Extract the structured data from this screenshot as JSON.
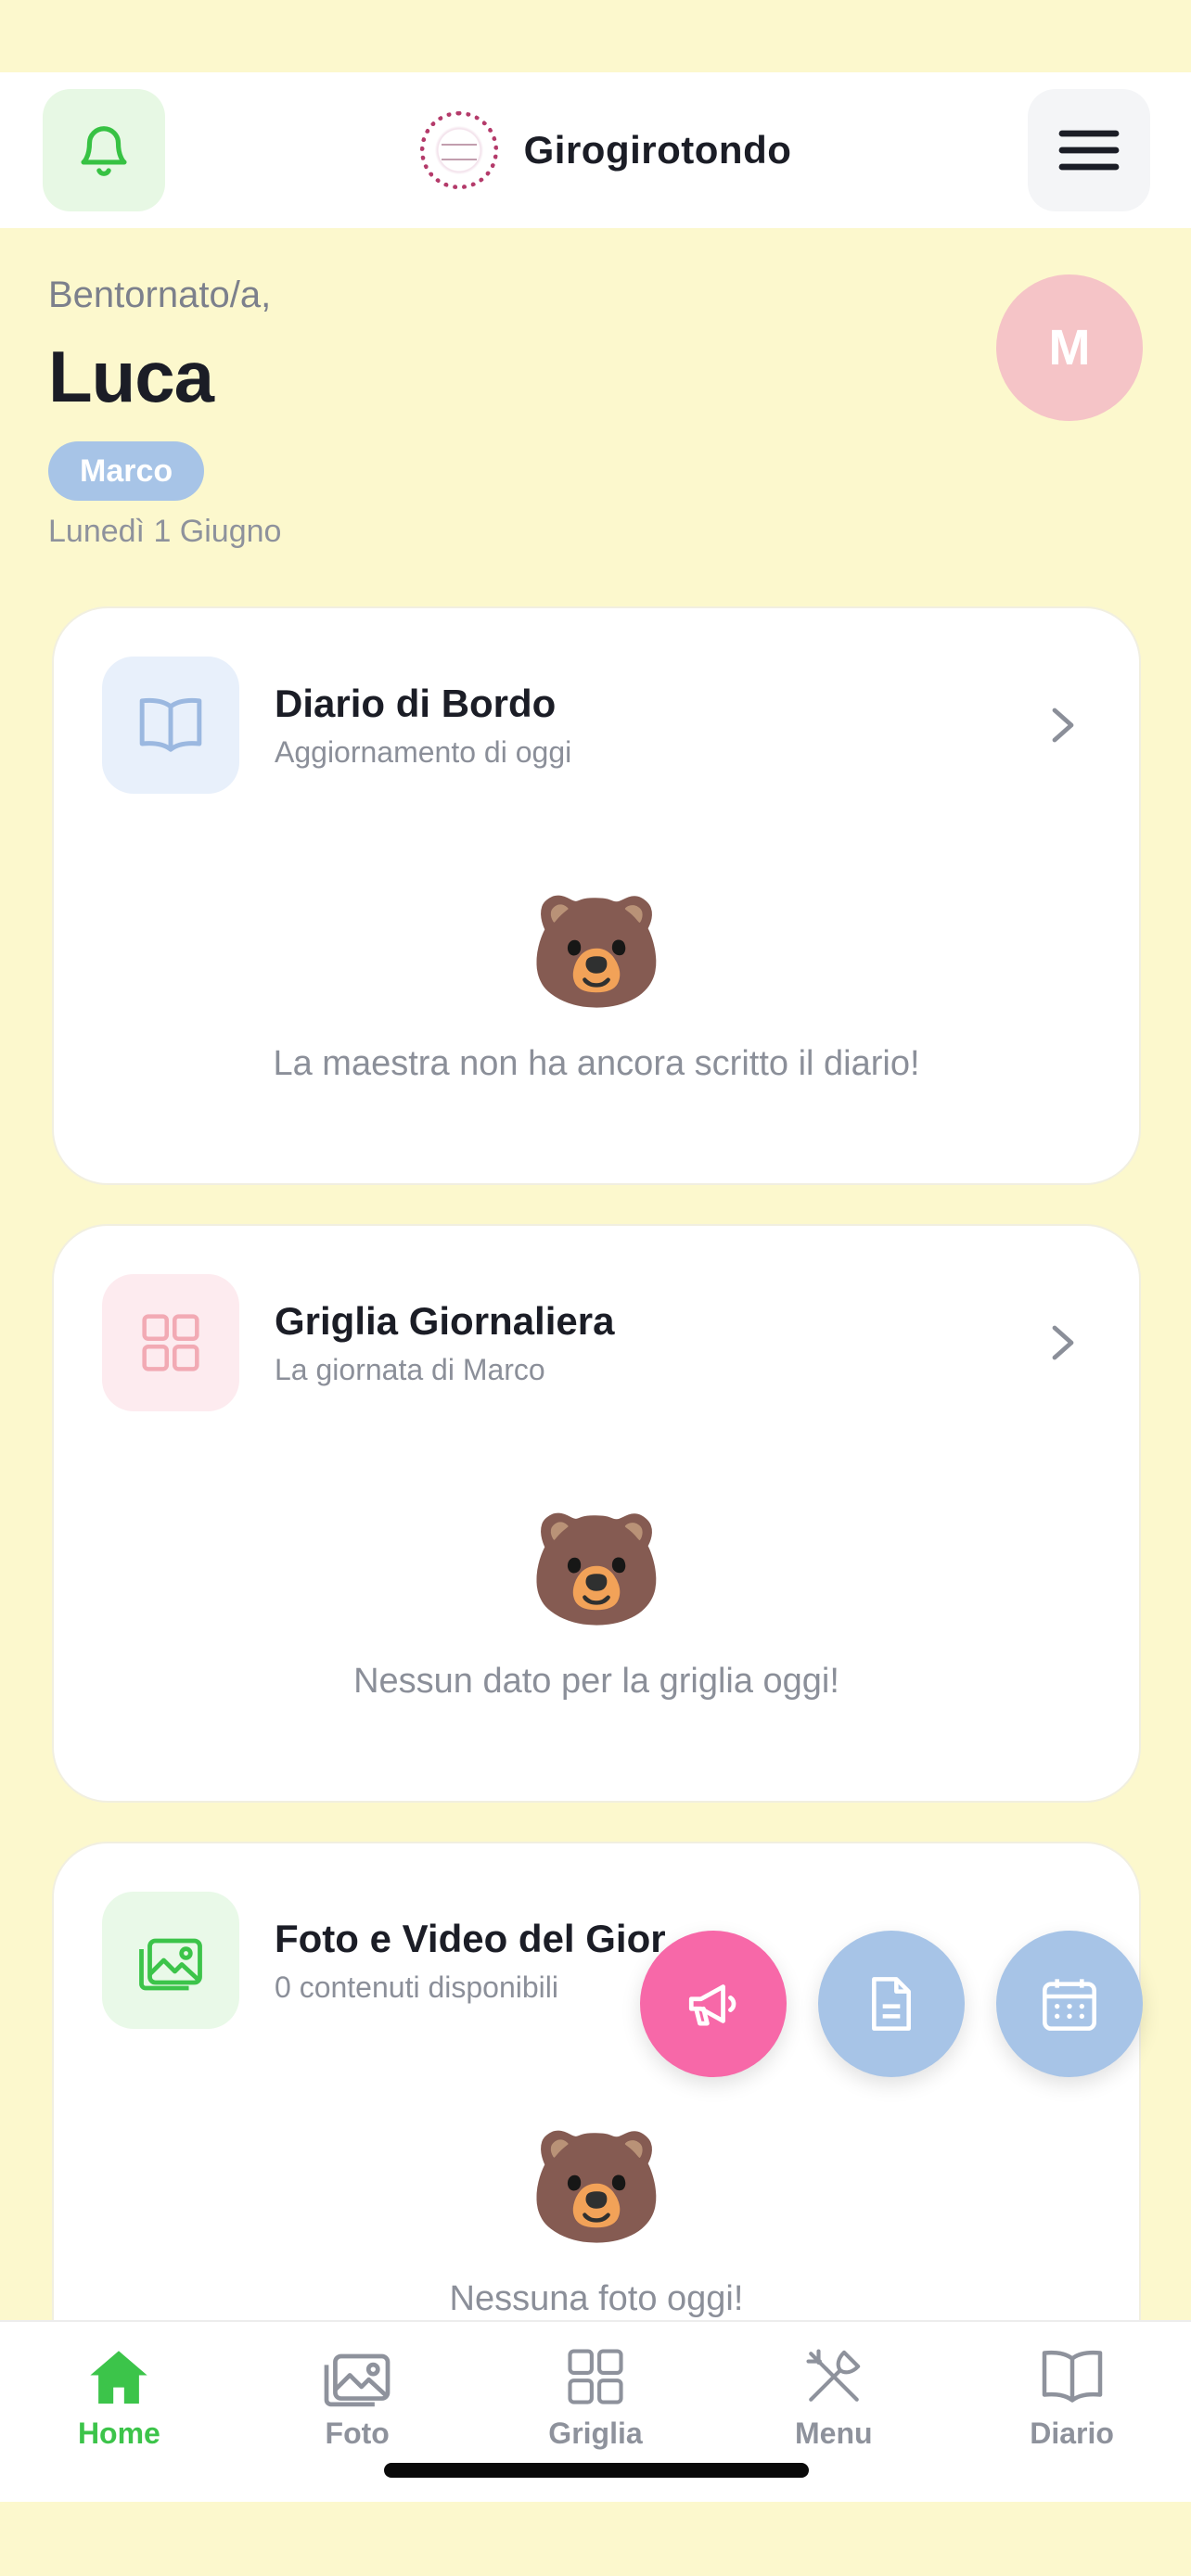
{
  "app": {
    "name": "Girogirotondo"
  },
  "header": {
    "notifications_icon": "bell-icon",
    "menu_icon": "hamburger-icon"
  },
  "greeting": {
    "hello": "Bentornato/a,",
    "name": "Luca",
    "child": "Marco",
    "date": "Lunedì 1 Giugno",
    "avatar_initial": "M"
  },
  "cards": {
    "diary": {
      "title": "Diario di Bordo",
      "subtitle": "Aggiornamento di oggi",
      "emoji": "🐻",
      "empty": "La maestra non ha ancora scritto il diario!"
    },
    "grid": {
      "title": "Griglia Giornaliera",
      "subtitle": "La giornata di Marco",
      "emoji": "🐻",
      "empty": "Nessun dato per la griglia oggi!"
    },
    "photos": {
      "title": "Foto e Video del Gior",
      "subtitle": "0 contenuti disponibili",
      "emoji": "🐻",
      "empty": "Nessuna foto oggi!"
    }
  },
  "fabs": [
    {
      "icon": "megaphone-icon",
      "color": "#F768A8"
    },
    {
      "icon": "document-icon",
      "color": "#A7C4E7"
    },
    {
      "icon": "calendar-icon",
      "color": "#A7C4E7"
    }
  ],
  "tabs": [
    {
      "label": "Home",
      "icon": "home-icon",
      "active": true
    },
    {
      "label": "Foto",
      "icon": "photo-icon",
      "active": false
    },
    {
      "label": "Griglia",
      "icon": "grid-icon",
      "active": false
    },
    {
      "label": "Menu",
      "icon": "cutlery-icon",
      "active": false
    },
    {
      "label": "Diario",
      "icon": "book-icon",
      "active": false
    }
  ],
  "colors": {
    "background": "#FCF8CD",
    "accent_green": "#3CC44A",
    "accent_pink": "#F768A8",
    "accent_blue": "#A7C4E7",
    "avatar_pink": "#F5C4C7"
  }
}
